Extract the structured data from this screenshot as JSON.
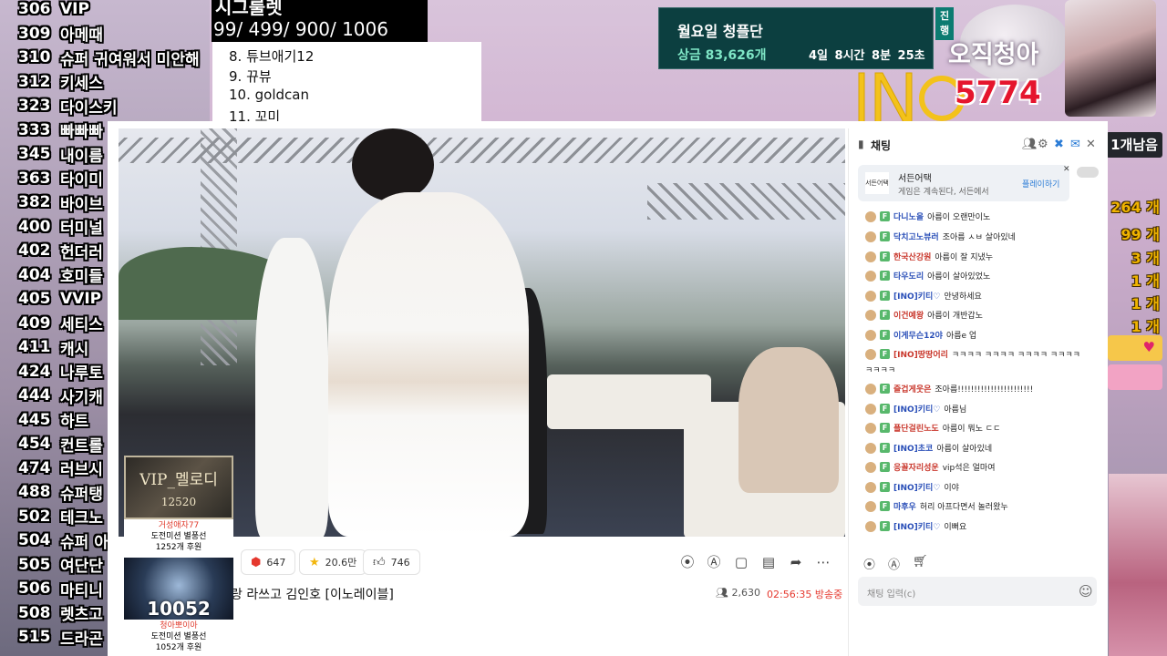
{
  "ranking": [
    {
      "num": "306",
      "name": "VIP"
    },
    {
      "num": "309",
      "name": "아메때"
    },
    {
      "num": "310",
      "name": "슈퍼 귀여워서 미안해"
    },
    {
      "num": "312",
      "name": "키세스"
    },
    {
      "num": "323",
      "name": "다이스키"
    },
    {
      "num": "333",
      "name": "빠빠빠"
    },
    {
      "num": "345",
      "name": "내이름"
    },
    {
      "num": "363",
      "name": "타이미"
    },
    {
      "num": "382",
      "name": "바이브"
    },
    {
      "num": "400",
      "name": "터미널"
    },
    {
      "num": "402",
      "name": "헌더러"
    },
    {
      "num": "404",
      "name": "호미들"
    },
    {
      "num": "405",
      "name": "VVIP"
    },
    {
      "num": "409",
      "name": "세티스"
    },
    {
      "num": "411",
      "name": "캐시"
    },
    {
      "num": "424",
      "name": "나루토"
    },
    {
      "num": "444",
      "name": "사기캐"
    },
    {
      "num": "445",
      "name": "하트"
    },
    {
      "num": "454",
      "name": "컨트롤"
    },
    {
      "num": "474",
      "name": "러브시"
    },
    {
      "num": "488",
      "name": "슈퍼탱"
    },
    {
      "num": "502",
      "name": "테크노"
    },
    {
      "num": "504",
      "name": "슈퍼 아"
    },
    {
      "num": "505",
      "name": "여단단"
    },
    {
      "num": "506",
      "name": "마티니"
    },
    {
      "num": "508",
      "name": "렛츠고"
    },
    {
      "num": "515",
      "name": "드라곤"
    }
  ],
  "signal": {
    "title": "시그룰렛",
    "values": "99/ 499/ 900/ 1006"
  },
  "top_list": [
    "8. 튜브애기12",
    "9. 뀨뷰",
    "10. goldcan",
    "11. 꼬미"
  ],
  "mission": {
    "title": "월요일 청플단",
    "prize": "상금 83,626개",
    "time": "4일 8시간  8분 25초",
    "tag": "진행"
  },
  "profile": {
    "name": "오직청아",
    "count": "5774"
  },
  "right_scores": [
    "264 개",
    "99 개",
    "3 개",
    "1 개",
    "1 개",
    "1 개"
  ],
  "right_badge": "1개남음",
  "player": {
    "likes_red": "647",
    "stars": "20.6만",
    "thumbs": "746",
    "title": "랑 라쓰고 김인호 [이노레이블]",
    "viewers": "2,630",
    "uptime": "02:56:35 방송중"
  },
  "chat": {
    "title": "채팅",
    "notice_logo": "서든어택",
    "notice_title": "서든어택",
    "notice_sub": "게임은 계속된다, 서든에서",
    "notice_btn": "플레이하기",
    "input_placeholder": "채팅 입력(c)",
    "messages": [
      {
        "nick": "다니노을",
        "color": "#2a4fb8",
        "text": "아름이 오랜만이노"
      },
      {
        "nick": "닥치고노뷰러",
        "color": "#2a4fb8",
        "text": "조아름 ㅅㅂ 살아있네"
      },
      {
        "nick": "한국산강원",
        "color": "#c9372c",
        "text": "아름이 잘 지냈누"
      },
      {
        "nick": "타우도리",
        "color": "#2a4fb8",
        "text": "아름이 살아있었노"
      },
      {
        "nick": "[INO]키티♡",
        "color": "#2a4fb8",
        "text": "안녕하세요"
      },
      {
        "nick": "이건예왕",
        "color": "#c9372c",
        "text": "아름이 개반갑노"
      },
      {
        "nick": "이게무슨12야",
        "color": "#2a4fb8",
        "text": "아름e 업"
      },
      {
        "nick": "[INO]땅땅어리",
        "color": "#c9372c",
        "text": "ㅋㅋㅋㅋ ㅋㅋㅋㅋ ㅋㅋㅋㅋ ㅋㅋㅋㅋ"
      },
      {
        "nick": "",
        "color": "#222",
        "text": "ㅋㅋㅋㅋ"
      },
      {
        "nick": "즐겁게웃은",
        "color": "#c9372c",
        "text": "조아름!!!!!!!!!!!!!!!!!!!!!!!"
      },
      {
        "nick": "[INO]키티♡",
        "color": "#2a4fb8",
        "text": "아름님"
      },
      {
        "nick": "플단걸린노도",
        "color": "#c9372c",
        "text": "아름이 뭐노 ㄷㄷ"
      },
      {
        "nick": "[INO]초코",
        "color": "#2a4fb8",
        "text": "아름이 살아있네"
      },
      {
        "nick": "응꼴자리성운",
        "color": "#c9372c",
        "text": "vip석은 얼마여"
      },
      {
        "nick": "[INO]키티♡",
        "color": "#2a4fb8",
        "text": "이야"
      },
      {
        "nick": "마후우",
        "color": "#2a4fb8",
        "text": "허리 아프다면서 놀러왔누"
      },
      {
        "nick": "[INO]키티♡",
        "color": "#2a4fb8",
        "text": "이뻐요"
      }
    ]
  },
  "donors": [
    {
      "img_line1": "VIP_멜로디",
      "img_line2": "12520",
      "name": "거성애자77",
      "line": "도전미션 별풍선",
      "amount": "1252개 후원"
    },
    {
      "img_line1": "10052",
      "img_line2": "",
      "name": "청아뽀이아",
      "line": "도전미션 별풍선",
      "amount": "1052개 후원"
    }
  ]
}
